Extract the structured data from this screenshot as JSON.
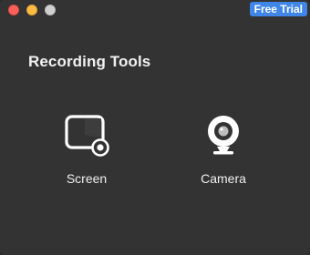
{
  "window": {
    "badge": "Free Trial",
    "title": "Recording Tools"
  },
  "tools": [
    {
      "label": "Screen",
      "icon": "screen-record-icon"
    },
    {
      "label": "Camera",
      "icon": "webcam-icon"
    }
  ],
  "colors": {
    "background": "#333333",
    "badge": "#3f86e8",
    "close": "#fc605b",
    "minimize": "#fdbc40",
    "maximize": "#d0d0d0"
  }
}
